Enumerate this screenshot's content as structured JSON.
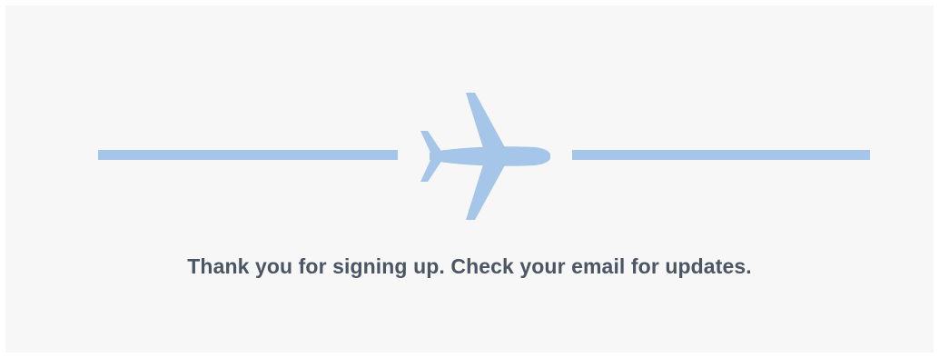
{
  "confirmation": {
    "icon": "airplane-icon",
    "message": "Thank you for signing up. Check your email for updates.",
    "accent_color": "#a5c6e8",
    "text_color": "#4b5563",
    "background_color": "#f7f7f8"
  }
}
